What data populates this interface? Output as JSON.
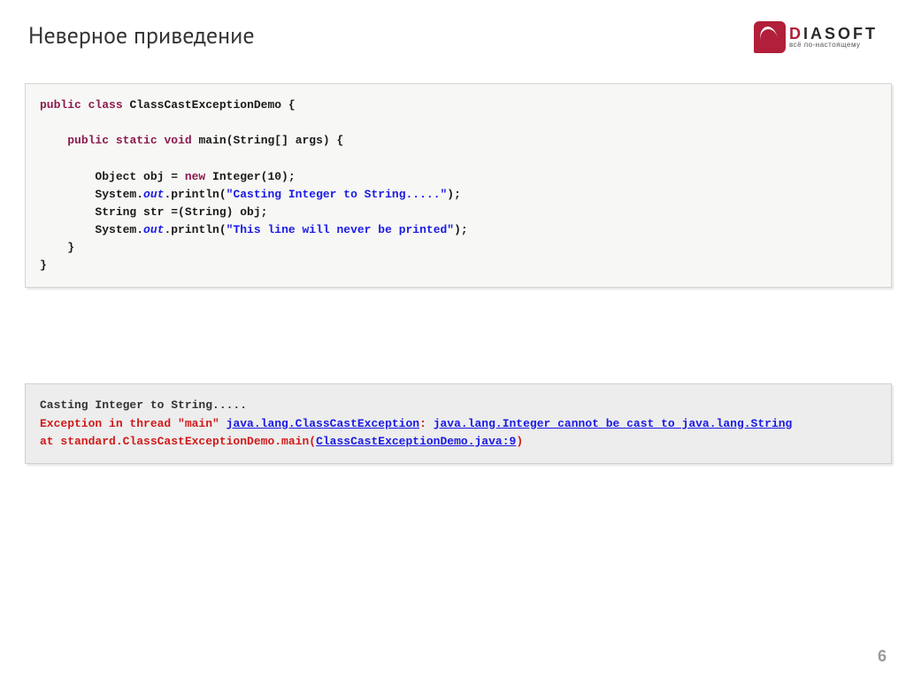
{
  "header": {
    "title": "Неверное приведение",
    "logo": {
      "brand_prefix": "D",
      "brand_rest": "IASOFT",
      "tagline": "всё по-настоящему"
    }
  },
  "code": {
    "kw_public": "public",
    "kw_class": "class",
    "kw_static": "static",
    "kw_void": "void",
    "kw_new": "new",
    "class_decl": " ClassCastExceptionDemo {",
    "main_decl_pre": " main(String[] args) {",
    "line_obj_a": "        Object obj = ",
    "line_obj_b": " Integer(10);",
    "line_print1_a": "        System.",
    "line_print1_out": "out",
    "line_print1_b": ".println(",
    "line_print1_str": "\"Casting Integer to String.....\"",
    "line_print1_c": ");",
    "line_cast": "        String str =(String) obj;",
    "line_print2_str": "\"This line will never be printed\"",
    "line_close1": "    }",
    "line_close2": "}"
  },
  "output": {
    "line1": "Casting Integer to String.....",
    "error_prefix": "Exception in thread \"main\" ",
    "error_link1": "java.lang.ClassCastException",
    "error_mid": ": ",
    "error_link2": "java.lang.Integer cannot be cast to java.lang.String",
    "trace_prefix": "at standard.ClassCastExceptionDemo.main(",
    "trace_link": "ClassCastExceptionDemo.java:9",
    "trace_suffix": ")"
  },
  "footer": {
    "page_number": "6"
  }
}
